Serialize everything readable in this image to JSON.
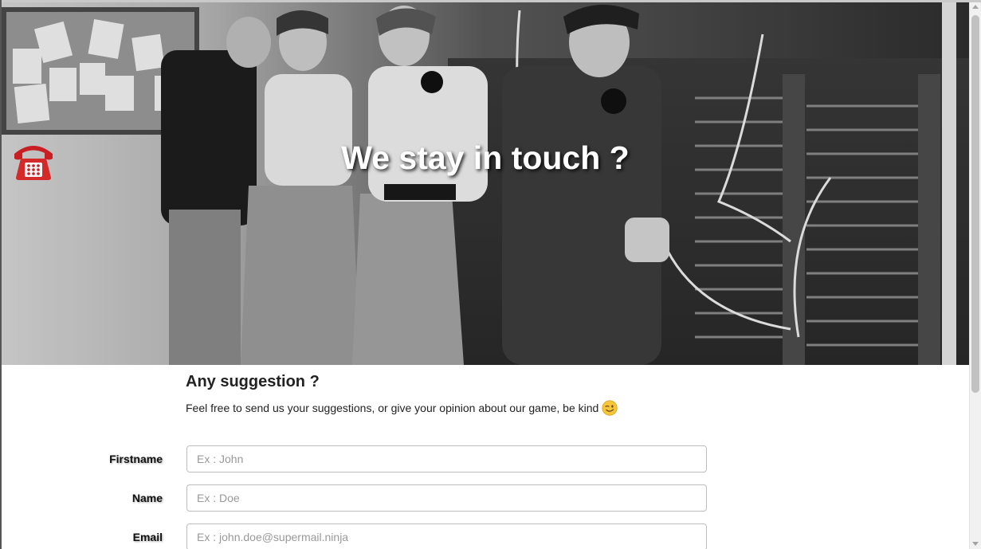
{
  "hero": {
    "title": "We stay in touch ?",
    "phone_icon": "telephone-emoji",
    "image": "vintage-switchboard-operators-photo"
  },
  "section": {
    "heading": "Any suggestion ?",
    "intro": "Feel free to send us your suggestions, or give your opinion about our game, be kind",
    "intro_icon": "winking-face-emoji"
  },
  "form": {
    "firstname": {
      "label": "Firstname",
      "placeholder": "Ex : John",
      "value": ""
    },
    "name": {
      "label": "Name",
      "placeholder": "Ex : Doe",
      "value": ""
    },
    "email": {
      "label": "Email",
      "placeholder": "Ex : john.doe@supermail.ninja",
      "value": ""
    }
  },
  "colors": {
    "text": "#222222",
    "border": "#bdbdbd",
    "placeholder": "#999999",
    "phone_red": "#d42a2a"
  }
}
